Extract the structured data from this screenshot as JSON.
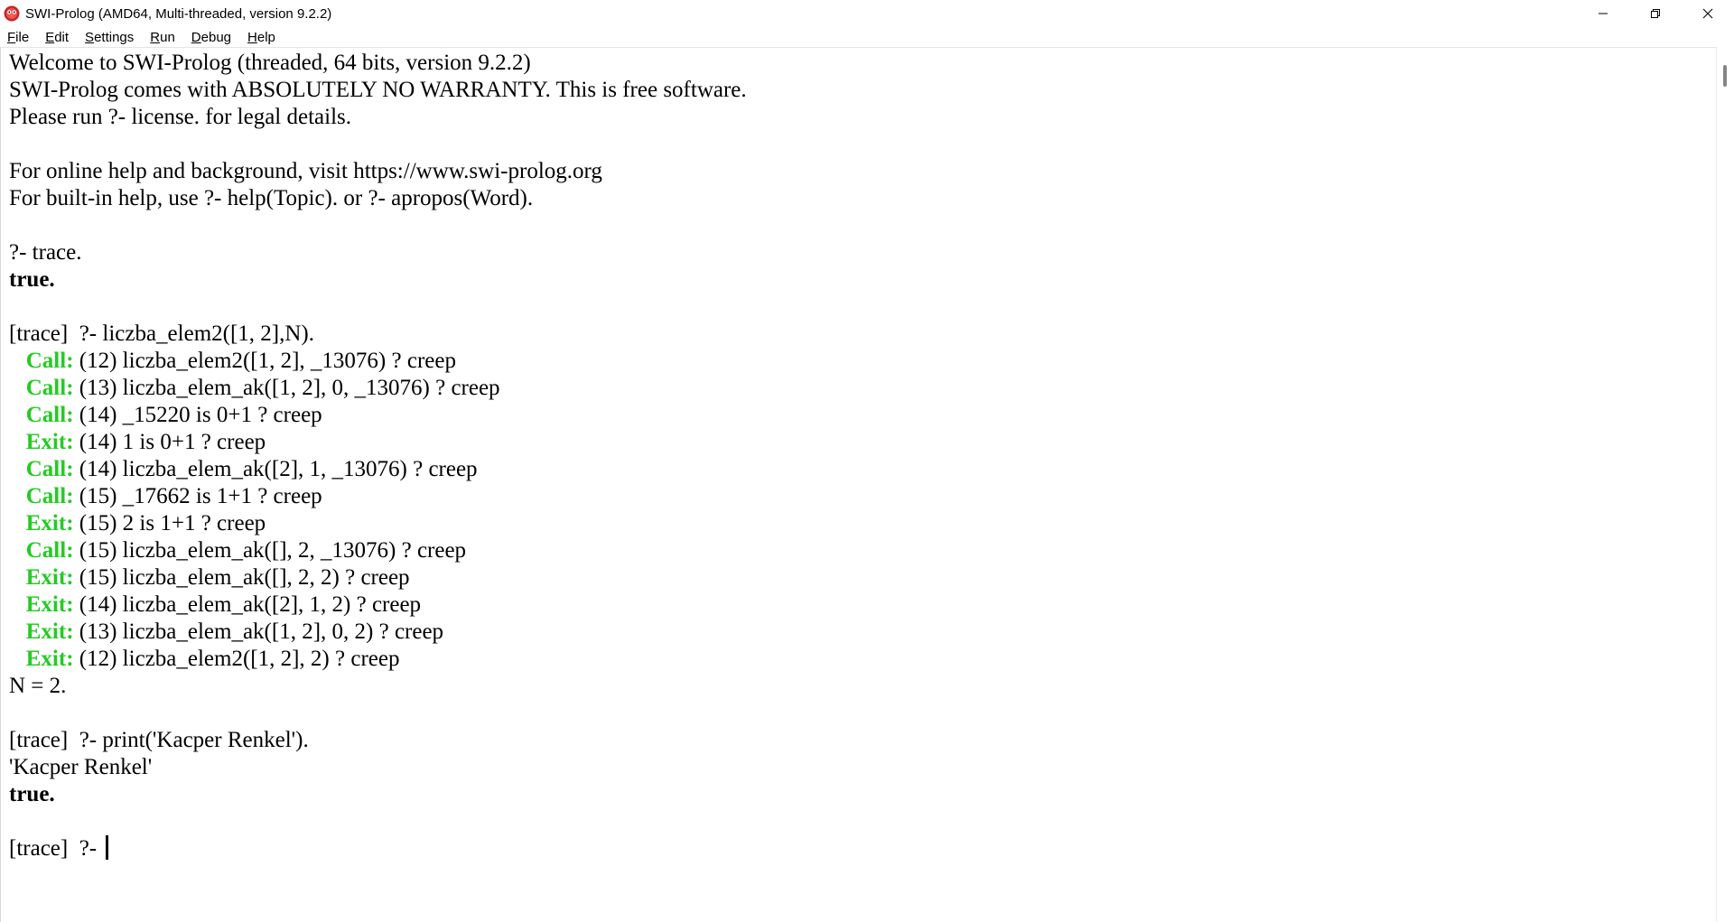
{
  "window": {
    "title": "SWI-Prolog (AMD64, Multi-threaded, version 9.2.2)",
    "icon": "swi-prolog-owl-icon",
    "controls": [
      "minimize-icon",
      "restore-icon",
      "close-icon"
    ]
  },
  "menu": {
    "items": [
      {
        "key": "F",
        "rest": "ile"
      },
      {
        "key": "E",
        "rest": "dit"
      },
      {
        "key": "S",
        "rest": "ettings"
      },
      {
        "key": "R",
        "rest": "un"
      },
      {
        "key": "D",
        "rest": "ebug"
      },
      {
        "key": "H",
        "rest": "elp"
      }
    ]
  },
  "console": {
    "welcome": [
      "Welcome to SWI-Prolog (threaded, 64 bits, version 9.2.2)",
      "SWI-Prolog comes with ABSOLUTELY NO WARRANTY. This is free software.",
      "Please run ?- license. for legal details.",
      "",
      "For online help and background, visit https://www.swi-prolog.org",
      "For built-in help, use ?- help(Topic). or ?- apropos(Word).",
      ""
    ],
    "q1": {
      "prompt": "?- trace.",
      "result": "true."
    },
    "q2": {
      "prompt": "[trace]  ?- liczba_elem2([1, 2],N).",
      "trace": [
        {
          "port": "Call:",
          "goal": " (12) liczba_elem2([1, 2], _13076) ? creep"
        },
        {
          "port": "Call:",
          "goal": " (13) liczba_elem_ak([1, 2], 0, _13076) ? creep"
        },
        {
          "port": "Call:",
          "goal": " (14) _15220 is 0+1 ? creep"
        },
        {
          "port": "Exit:",
          "goal": " (14) 1 is 0+1 ? creep"
        },
        {
          "port": "Call:",
          "goal": " (14) liczba_elem_ak([2], 1, _13076) ? creep"
        },
        {
          "port": "Call:",
          "goal": " (15) _17662 is 1+1 ? creep"
        },
        {
          "port": "Exit:",
          "goal": " (15) 2 is 1+1 ? creep"
        },
        {
          "port": "Call:",
          "goal": " (15) liczba_elem_ak([], 2, _13076) ? creep"
        },
        {
          "port": "Exit:",
          "goal": " (15) liczba_elem_ak([], 2, 2) ? creep"
        },
        {
          "port": "Exit:",
          "goal": " (14) liczba_elem_ak([2], 1, 2) ? creep"
        },
        {
          "port": "Exit:",
          "goal": " (13) liczba_elem_ak([1, 2], 0, 2) ? creep"
        },
        {
          "port": "Exit:",
          "goal": " (12) liczba_elem2([1, 2], 2) ? creep"
        }
      ],
      "result": "N = 2."
    },
    "q3": {
      "prompt": "[trace]  ?- print('Kacper Renkel').",
      "output": "'Kacper Renkel'",
      "result": "true."
    },
    "current_prompt": "[trace]  ?- ",
    "port_color": "#22cc22"
  }
}
